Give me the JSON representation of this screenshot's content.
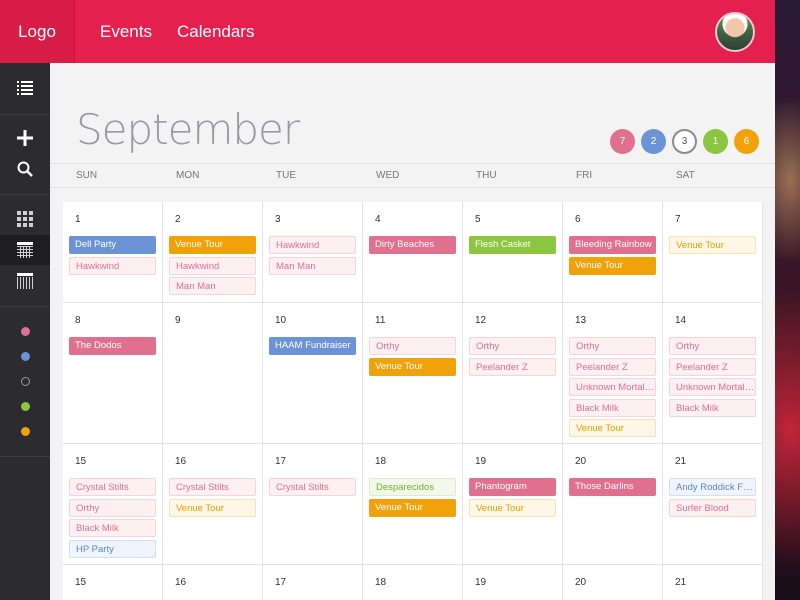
{
  "header": {
    "logo": "Logo",
    "nav": [
      "Events",
      "Calendars"
    ]
  },
  "sidebar": {
    "icons": [
      "list-icon",
      "plus-icon",
      "search-icon",
      "grid-view-icon",
      "month-view-icon",
      "week-view-icon"
    ],
    "calendar_dots": [
      "#e0708e",
      "#6b93d6",
      "ring",
      "#8cc540",
      "#f1a20a"
    ]
  },
  "month": "September",
  "filters": [
    {
      "count": "7",
      "color": "#e0708e"
    },
    {
      "count": "2",
      "color": "#6b93d6"
    },
    {
      "count": "3",
      "color": "ring"
    },
    {
      "count": "1",
      "color": "#8cc540"
    },
    {
      "count": "6",
      "color": "#f1a20a"
    }
  ],
  "weekdays": [
    "SUN",
    "MON",
    "TUE",
    "WED",
    "THU",
    "FRI",
    "SAT"
  ],
  "weeks": [
    [
      {
        "day": "1",
        "events": [
          {
            "t": "Dell Party",
            "s": "solid-blue"
          },
          {
            "t": "Hawkwind",
            "s": "light-pink"
          }
        ]
      },
      {
        "day": "2",
        "events": [
          {
            "t": "Venue Tour",
            "s": "solid-orange"
          },
          {
            "t": "Hawkwind",
            "s": "light-pink"
          },
          {
            "t": "Man Man",
            "s": "light-pink"
          }
        ]
      },
      {
        "day": "3",
        "events": [
          {
            "t": "Hawkwind",
            "s": "light-pink"
          },
          {
            "t": "Man Man",
            "s": "light-pink"
          }
        ]
      },
      {
        "day": "4",
        "events": [
          {
            "t": "Dirty Beaches",
            "s": "solid-pink"
          }
        ]
      },
      {
        "day": "5",
        "events": [
          {
            "t": "Flesh Casket",
            "s": "solid-green"
          }
        ]
      },
      {
        "day": "6",
        "events": [
          {
            "t": "Bleeding Rainbow",
            "s": "solid-pink"
          },
          {
            "t": "Venue Tour",
            "s": "solid-orange"
          }
        ]
      },
      {
        "day": "7",
        "events": [
          {
            "t": "Venue Tour",
            "s": "light-orange"
          }
        ]
      }
    ],
    [
      {
        "day": "8",
        "events": [
          {
            "t": "The Dodos",
            "s": "solid-pink"
          }
        ]
      },
      {
        "day": "9",
        "events": []
      },
      {
        "day": "10",
        "events": [
          {
            "t": "HAAM Fundraiser",
            "s": "solid-blue"
          }
        ]
      },
      {
        "day": "11",
        "events": [
          {
            "t": "Orthy",
            "s": "light-pink"
          },
          {
            "t": "Venue Tour",
            "s": "solid-orange"
          }
        ]
      },
      {
        "day": "12",
        "events": [
          {
            "t": "Orthy",
            "s": "light-pink"
          },
          {
            "t": "Peelander Z",
            "s": "light-pink"
          }
        ]
      },
      {
        "day": "13",
        "events": [
          {
            "t": "Orthy",
            "s": "light-pink"
          },
          {
            "t": "Peelander Z",
            "s": "light-pink"
          },
          {
            "t": "Unknown Mortal Orchestra",
            "s": "light-pink"
          },
          {
            "t": "Black Milk",
            "s": "light-pink"
          },
          {
            "t": "Venue Tour",
            "s": "light-orange"
          }
        ]
      },
      {
        "day": "14",
        "events": [
          {
            "t": "Orthy",
            "s": "light-pink"
          },
          {
            "t": "Peelander Z",
            "s": "light-pink"
          },
          {
            "t": "Unknown Mortal Orchestra",
            "s": "light-pink"
          },
          {
            "t": "Black Milk",
            "s": "light-pink"
          }
        ]
      }
    ],
    [
      {
        "day": "15",
        "events": [
          {
            "t": "Crystal Stilts",
            "s": "light-pink"
          },
          {
            "t": "Orthy",
            "s": "light-pink"
          },
          {
            "t": "Black Milk",
            "s": "light-pink"
          },
          {
            "t": "HP Party",
            "s": "light-blue"
          }
        ]
      },
      {
        "day": "16",
        "events": [
          {
            "t": "Crystal Stilts",
            "s": "light-pink"
          },
          {
            "t": "Venue Tour",
            "s": "light-orange"
          }
        ]
      },
      {
        "day": "17",
        "events": [
          {
            "t": "Crystal Stilts",
            "s": "light-pink"
          }
        ]
      },
      {
        "day": "18",
        "events": [
          {
            "t": "Desparecidos",
            "s": "light-green"
          },
          {
            "t": "Venue Tour",
            "s": "solid-orange"
          }
        ]
      },
      {
        "day": "19",
        "events": [
          {
            "t": "Phantogram",
            "s": "solid-pink"
          },
          {
            "t": "Venue Tour",
            "s": "light-orange"
          }
        ]
      },
      {
        "day": "20",
        "events": [
          {
            "t": "Those Darlins",
            "s": "solid-pink"
          }
        ]
      },
      {
        "day": "21",
        "events": [
          {
            "t": "Andy Roddick Foundation",
            "s": "light-blue"
          },
          {
            "t": "Surfer Blood",
            "s": "light-pink"
          }
        ]
      }
    ],
    [
      {
        "day": "15",
        "events": []
      },
      {
        "day": "16",
        "events": []
      },
      {
        "day": "17",
        "events": []
      },
      {
        "day": "18",
        "events": []
      },
      {
        "day": "19",
        "events": []
      },
      {
        "day": "20",
        "events": []
      },
      {
        "day": "21",
        "events": []
      }
    ]
  ]
}
